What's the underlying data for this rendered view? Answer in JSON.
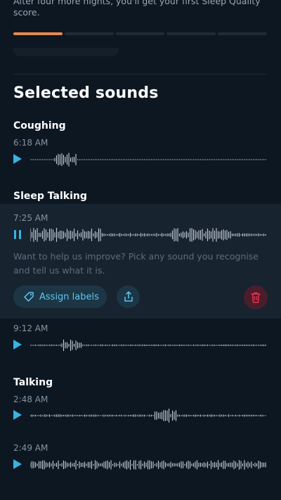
{
  "header": {
    "intro_text": "After four more nights, you'll get your first Sleep Quality score.",
    "progress_segments": 5,
    "progress_filled": 1,
    "progress_color": "#e8894e"
  },
  "section_title": "Selected sounds",
  "groups": [
    {
      "title": "Coughing",
      "recordings": [
        {
          "time": "6:18 AM",
          "state": "paused"
        }
      ]
    },
    {
      "title": "Sleep Talking",
      "recordings": [
        {
          "time": "7:25 AM",
          "state": "playing"
        },
        {
          "time": "9:12 AM",
          "state": "paused"
        }
      ]
    },
    {
      "title": "Talking",
      "recordings": [
        {
          "time": "2:48 AM",
          "state": "paused"
        },
        {
          "time": "2:49 AM",
          "state": "paused"
        }
      ]
    }
  ],
  "expanded": {
    "help_text": "Want to help us improve? Pick any sound you recognise and tell us what it is.",
    "assign_label": "Assign labels",
    "icons": {
      "assign": "tag-icon",
      "share": "share-icon",
      "delete": "trash-icon"
    }
  },
  "colors": {
    "accent": "#39b3e0",
    "danger": "#e3334f",
    "background": "#0c1722"
  }
}
